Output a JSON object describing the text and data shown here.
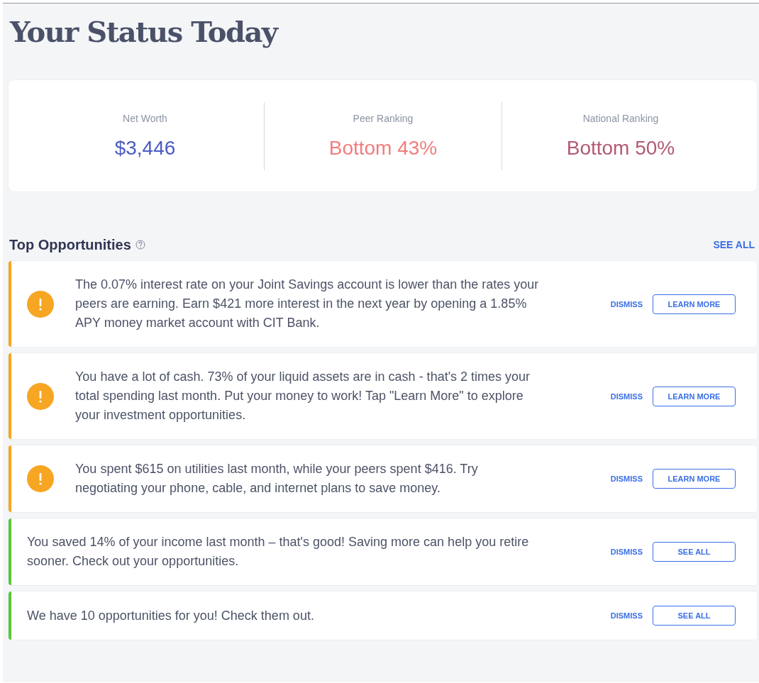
{
  "title": "Your Status Today",
  "stats": [
    {
      "label": "Net Worth",
      "value": "$3,446",
      "color": "#4a5cc5"
    },
    {
      "label": "Peer Ranking",
      "value": "Bottom 43%",
      "color": "#f27d7d"
    },
    {
      "label": "National Ranking",
      "value": "Bottom 50%",
      "color": "#b25a72"
    }
  ],
  "opportunities": {
    "heading": "Top Opportunities",
    "see_all": "SEE ALL",
    "items": [
      {
        "kind": "alert",
        "text": "The 0.07% interest rate on your Joint Savings account is lower than the rates your peers are earning. Earn $421 more interest in the next year by opening a 1.85% APY money market account with CIT Bank.",
        "dismiss": "DISMISS",
        "action": "LEARN MORE"
      },
      {
        "kind": "alert",
        "text": "You have a lot of cash. 73% of your liquid assets are in cash - that's 2 times your total spending last month. Put your money to work! Tap \"Learn More\" to explore your investment opportunities.",
        "dismiss": "DISMISS",
        "action": "LEARN MORE"
      },
      {
        "kind": "alert",
        "text": "You spent $615 on utilities last month, while your peers spent $416. Try negotiating your phone, cable, and internet plans to save money.",
        "dismiss": "DISMISS",
        "action": "LEARN MORE"
      },
      {
        "kind": "tip",
        "text": "You saved 14% of your income last month – that's good! Saving more can help you retire sooner. Check out your opportunities.",
        "dismiss": "DISMISS",
        "action": "SEE ALL"
      },
      {
        "kind": "tip",
        "text": "We have 10 opportunities for you! Check them out.",
        "dismiss": "DISMISS",
        "action": "SEE ALL"
      }
    ]
  }
}
